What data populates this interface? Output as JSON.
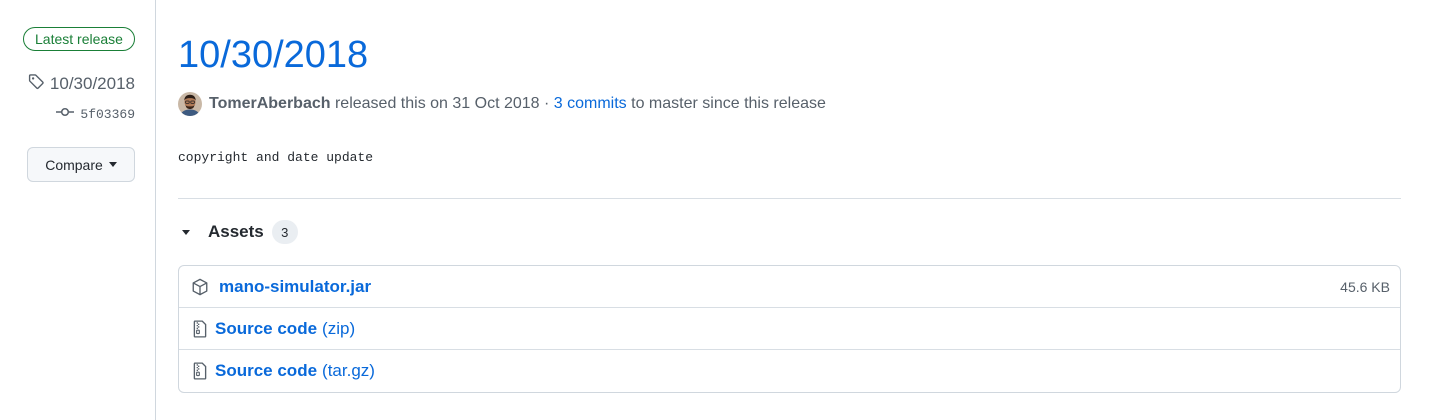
{
  "sidebar": {
    "latest_badge": "Latest release",
    "tag": "10/30/2018",
    "commit": "5f03369",
    "compare_label": "Compare"
  },
  "release": {
    "title": "10/30/2018",
    "author": "TomerAberbach",
    "released_text": "released this on 31 Oct 2018 ·",
    "commits_link": "3 commits",
    "since_text": "to master since this release",
    "notes": "copyright and date update"
  },
  "assets": {
    "label": "Assets",
    "count": "3",
    "items": [
      {
        "name": "mano-simulator.jar",
        "suffix": "",
        "size": "45.6 KB",
        "icon": "package-icon"
      },
      {
        "name": "Source code",
        "suffix": "(zip)",
        "size": "",
        "icon": "file-zip-icon"
      },
      {
        "name": "Source code",
        "suffix": "(tar.gz)",
        "size": "",
        "icon": "file-zip-icon"
      }
    ]
  },
  "colors": {
    "link": "#0969da",
    "success": "#1a7f37",
    "muted": "#57606a",
    "border": "#d0d7de"
  }
}
